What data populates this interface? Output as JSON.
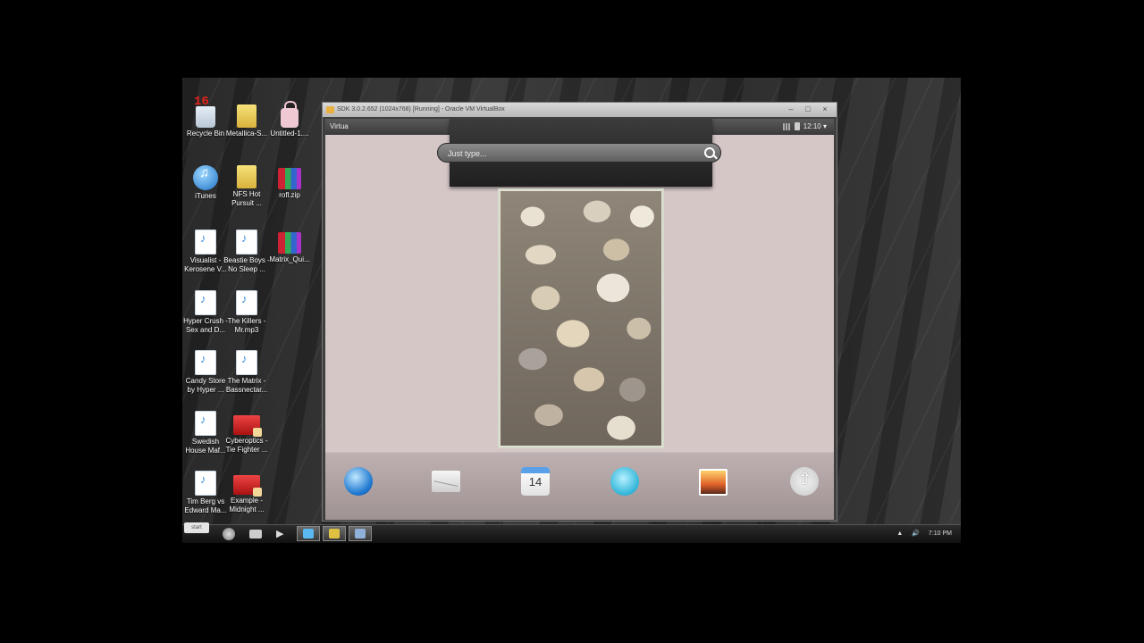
{
  "desktop": {
    "icons": [
      {
        "label": "Recycle Bin",
        "icon": "recycle-bin-icon",
        "badge": "16"
      },
      {
        "label": "Metallica-S...",
        "icon": "folder-icon"
      },
      {
        "label": "Untitled-1....",
        "icon": "lock-icon"
      },
      {
        "label": "iTunes",
        "icon": "itunes-icon"
      },
      {
        "label": "NFS Hot Pursuit ...",
        "icon": "folder-icon"
      },
      {
        "label": "rofl.zip",
        "icon": "archive-icon"
      },
      {
        "label": "Visualist - Kerosene V...",
        "icon": "audio-file-icon"
      },
      {
        "label": "Beastie Boys - No Sleep ...",
        "icon": "audio-file-icon"
      },
      {
        "label": "Matrix_Qui...",
        "icon": "archive-icon"
      },
      {
        "label": "Hyper Crush -Sex and D...",
        "icon": "audio-file-icon"
      },
      {
        "label": "The Killers - Mr.mp3",
        "icon": "audio-file-icon"
      },
      {
        "label": "Candy Store by Hyper ...",
        "icon": "audio-file-icon"
      },
      {
        "label": "The Matrix - Bassnectar...",
        "icon": "audio-file-icon"
      },
      {
        "label": "Swedish House Maf...",
        "icon": "audio-file-icon"
      },
      {
        "label": "Cyberoptics - Tie Fighter ...",
        "icon": "application-icon"
      },
      {
        "label": "Tim Berg vs Edward Ma...",
        "icon": "audio-file-icon"
      },
      {
        "label": "Example - Midnight ...",
        "icon": "application-icon"
      }
    ]
  },
  "vbox": {
    "title": "SDK 3.0.2.652 (1024x768) [Running] - Oracle VM VirtualBox",
    "minimize": "–",
    "maximize": "□",
    "close": "×"
  },
  "emulator": {
    "status": {
      "app": "Virtua",
      "time": "12:10",
      "menu": "▾"
    },
    "search": {
      "placeholder": "Just type..."
    },
    "calendar_day": "14",
    "dock": [
      "browser-icon",
      "email-icon",
      "calendar-icon",
      "messaging-icon",
      "photos-icon",
      "launcher-icon"
    ]
  },
  "taskbar": {
    "start": "start",
    "tray": {
      "arrow": "▲",
      "volume": "🔊",
      "clock": "7:10 PM"
    }
  },
  "colors": {
    "accent": "#3c8ce0",
    "badge": "#e2231a"
  }
}
